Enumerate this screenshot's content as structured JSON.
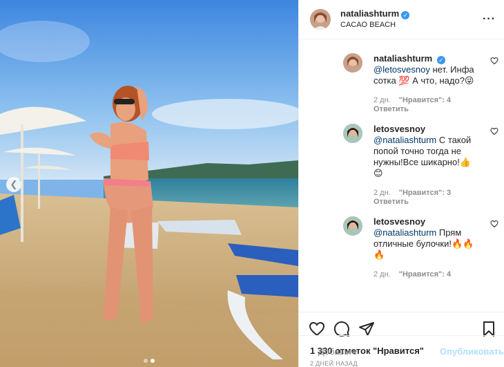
{
  "post": {
    "username": "nataliashturm",
    "location": "CACAO BEACH",
    "likes_text": "1 330 отметок \"Нравится\"",
    "date_text": "2 ДНЕЙ НАЗАД"
  },
  "comments": [
    {
      "username": "nataliashturm",
      "verified": true,
      "mention": "@letosvesnoy",
      "text": " нет. Инфа сотка 💯 А что, надо?😜",
      "time": "2 дн.",
      "likes": "\"Нравится\": 4",
      "reply": "Ответить"
    },
    {
      "username": "letosvesnoy",
      "verified": false,
      "mention": "@nataliashturm",
      "text": " С такой попой точно тогда не нужны!Все шикарно!👍😊",
      "time": "2 дн.",
      "likes": "\"Нравится\": 3",
      "reply": "Ответить"
    },
    {
      "username": "letosvesnoy",
      "verified": false,
      "mention": "@nataliashturm",
      "text": " Прям отличные булочки!🔥🔥🔥",
      "time": "2 дн.",
      "likes": "\"Нравится\": 4",
      "reply": ""
    }
  ],
  "comment_box": {
    "placeholder": "Добавьте",
    "publish_label": "Опубликовать"
  },
  "icons": {
    "more": "more-options-icon",
    "verified": "verified-badge-icon",
    "like": "heart-icon",
    "comment": "comment-icon",
    "share": "share-icon",
    "save": "bookmark-icon",
    "emoji": "emoji-icon",
    "prev": "chevron-left-icon"
  },
  "colors": {
    "link": "#00376b",
    "verified": "#3897f0",
    "publish_disabled": "#b2dffc",
    "muted": "#8e8e8e"
  }
}
